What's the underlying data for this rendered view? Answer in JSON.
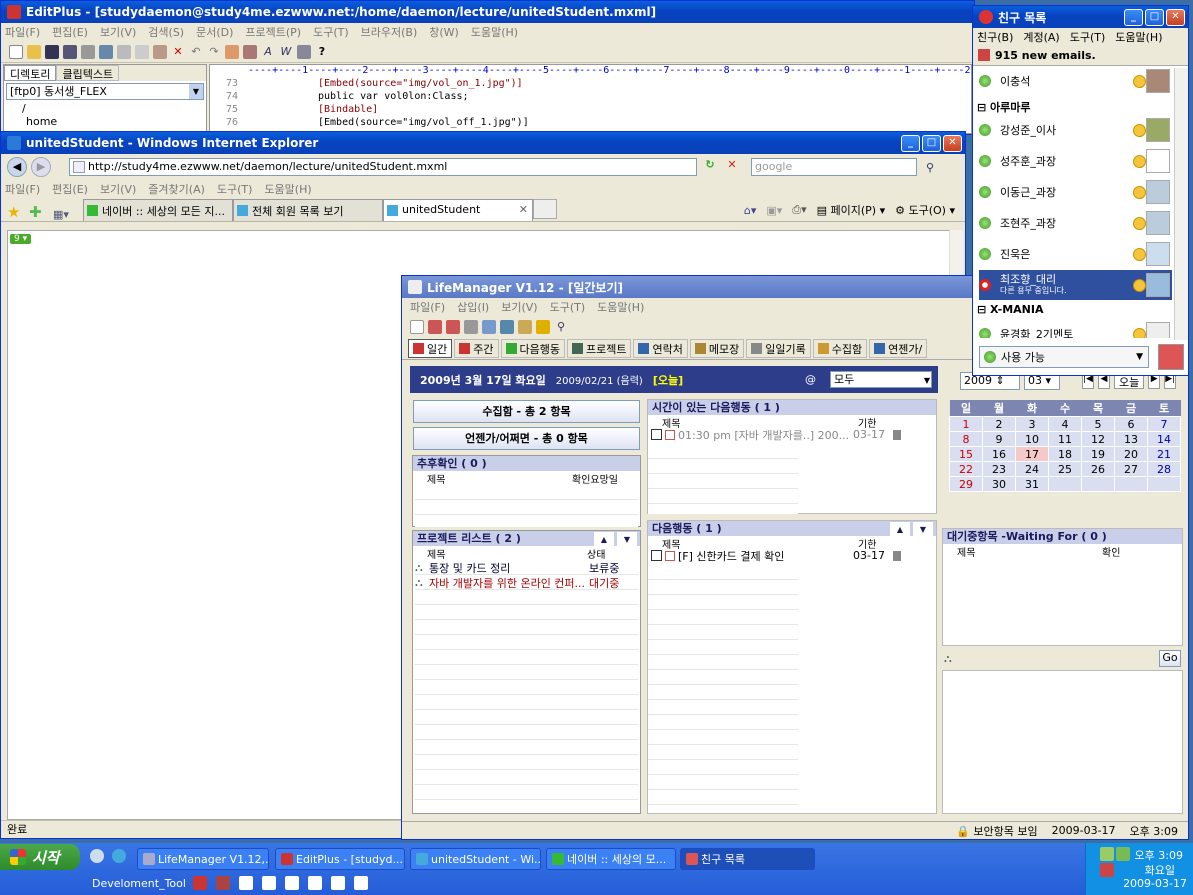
{
  "editplus": {
    "title": "EditPlus - [studydaemon@study4me.ezwww.net:/home/daemon/lecture/unitedStudent.mxml]",
    "menus": [
      "파일(F)",
      "편집(E)",
      "보기(V)",
      "검색(S)",
      "문서(D)",
      "프로젝트(P)",
      "도구(T)",
      "브라우저(B)",
      "창(W)",
      "도움말(H)"
    ],
    "tabs": [
      "디렉토리",
      "클립텍스트"
    ],
    "ftp": "[ftp0] 동서생_FLEX",
    "tree": [
      "/",
      "home"
    ],
    "ruler": "----+----1----+----2----+----3----+----4----+----5----+----6----+----7----+----8----+----9----+----0----+----1----+----2",
    "lines": [
      {
        "n": "73",
        "code": "[Embed(source=\"img/vol_on_1.jpg\")]"
      },
      {
        "n": "74",
        "code": "public var vol0lon:Class;"
      },
      {
        "n": "75",
        "code": "[Bindable]"
      },
      {
        "n": "76",
        "code": "[Embed(source=\"img/vol_off_1.jpg\")]"
      }
    ]
  },
  "ie": {
    "title": "unitedStudent - Windows Internet Explorer",
    "url": "http://study4me.ezwww.net/daemon/lecture/unitedStudent.mxml",
    "search": "google",
    "menus": [
      "파일(F)",
      "편집(E)",
      "보기(V)",
      "즐겨찾기(A)",
      "도구(T)",
      "도움말(H)"
    ],
    "tabs": [
      "네이버 :: 세상의 모든 지...",
      "전체 회원 목록 보기",
      "unitedStudent"
    ],
    "page_btn": "페이지(P)",
    "tools_btn": "도구(O)",
    "flash_badge": "9",
    "status": "완료"
  },
  "lm": {
    "title": "LifeManager V1.12 - [일간보기]",
    "menus": [
      "파일(F)",
      "삽입(I)",
      "보기(V)",
      "도구(T)",
      "도움말(H)"
    ],
    "views": [
      "일간",
      "주간",
      "다음행동",
      "프로젝트",
      "연락처",
      "메모장",
      "일일기록",
      "수집함",
      "연젠가/"
    ],
    "date": "2009년 3월 17일 화요일",
    "lunar": "2009/02/21 (음력)",
    "today": "[오늘]",
    "filter": "모두",
    "inbox": "수집함 - 총 2 항목",
    "someday": "언젠가/어쩌면 - 총 0 항목",
    "followup": {
      "title": "추후확인 ( 0 )",
      "cols": [
        "제목",
        "확인요망일"
      ]
    },
    "projects": {
      "title": "프로젝트 리스트 ( 2 )",
      "cols": [
        "제목",
        "상태"
      ],
      "rows": [
        {
          "name": "통장 및 카드 정리",
          "status": "보류중"
        },
        {
          "name": "자바 개발자를 위한 온라인 컨퍼...",
          "status": "대기중"
        }
      ]
    },
    "timed": {
      "title": "시간이 있는 다음행동 ( 1 )",
      "cols": [
        "제목",
        "기한"
      ],
      "rows": [
        {
          "text": "01:30 pm [자바 개발자를..] 200...",
          "due": "03-17"
        }
      ]
    },
    "next": {
      "title": "다음행동 ( 1 )",
      "cols": [
        "제목",
        "기한"
      ],
      "rows": [
        {
          "text": "[F] 신한카드 결제 확인",
          "due": "03-17"
        }
      ]
    },
    "waiting": {
      "title": "대기중항목 -Waiting For ( 0 )",
      "cols": [
        "제목",
        "확인"
      ]
    },
    "cal": {
      "year": "2009",
      "month": "03",
      "today_btn": "오늘",
      "days": [
        "일",
        "월",
        "화",
        "수",
        "목",
        "금",
        "토"
      ],
      "weeks": [
        [
          "1",
          "2",
          "3",
          "4",
          "5",
          "6",
          "7"
        ],
        [
          "8",
          "9",
          "10",
          "11",
          "12",
          "13",
          "14"
        ],
        [
          "15",
          "16",
          "17",
          "18",
          "19",
          "20",
          "21"
        ],
        [
          "22",
          "23",
          "24",
          "25",
          "26",
          "27",
          "28"
        ],
        [
          "29",
          "30",
          "31",
          "",
          "",
          "",
          ""
        ]
      ]
    },
    "go": "Go",
    "status": {
      "secure": "보안항목 보임",
      "date": "2009-03-17",
      "time": "오후 3:09"
    }
  },
  "buddy": {
    "title": "친구 목록",
    "menus": [
      "친구(B)",
      "계정(A)",
      "도구(T)",
      "도움말(H)"
    ],
    "emails": "915 new emails.",
    "friends": [
      {
        "name": "이충석"
      },
      {
        "group": "아루마루"
      },
      {
        "name": "강성준_이사"
      },
      {
        "name": "성주훈_과장"
      },
      {
        "name": "이동근_과장"
      },
      {
        "name": "조현주_과장"
      },
      {
        "name": "진욱은"
      },
      {
        "name": "최조향_대리",
        "sub": "다른 용무 중입니다.",
        "busy": true
      },
      {
        "group": "X-MANIA"
      },
      {
        "name": "윤경화_2기멘토"
      }
    ],
    "status": "사용 가능"
  },
  "taskbar": {
    "start": "시작",
    "items": [
      "LifeManager V1.12,...",
      "EditPlus - [studyd...",
      "unitedStudent - Wi...",
      "네이버 :: 세상의 모...",
      "친구 목록"
    ],
    "quick": "Develoment_Tool",
    "time": "오후 3:09",
    "day": "화요일",
    "date": "2009-03-17"
  }
}
